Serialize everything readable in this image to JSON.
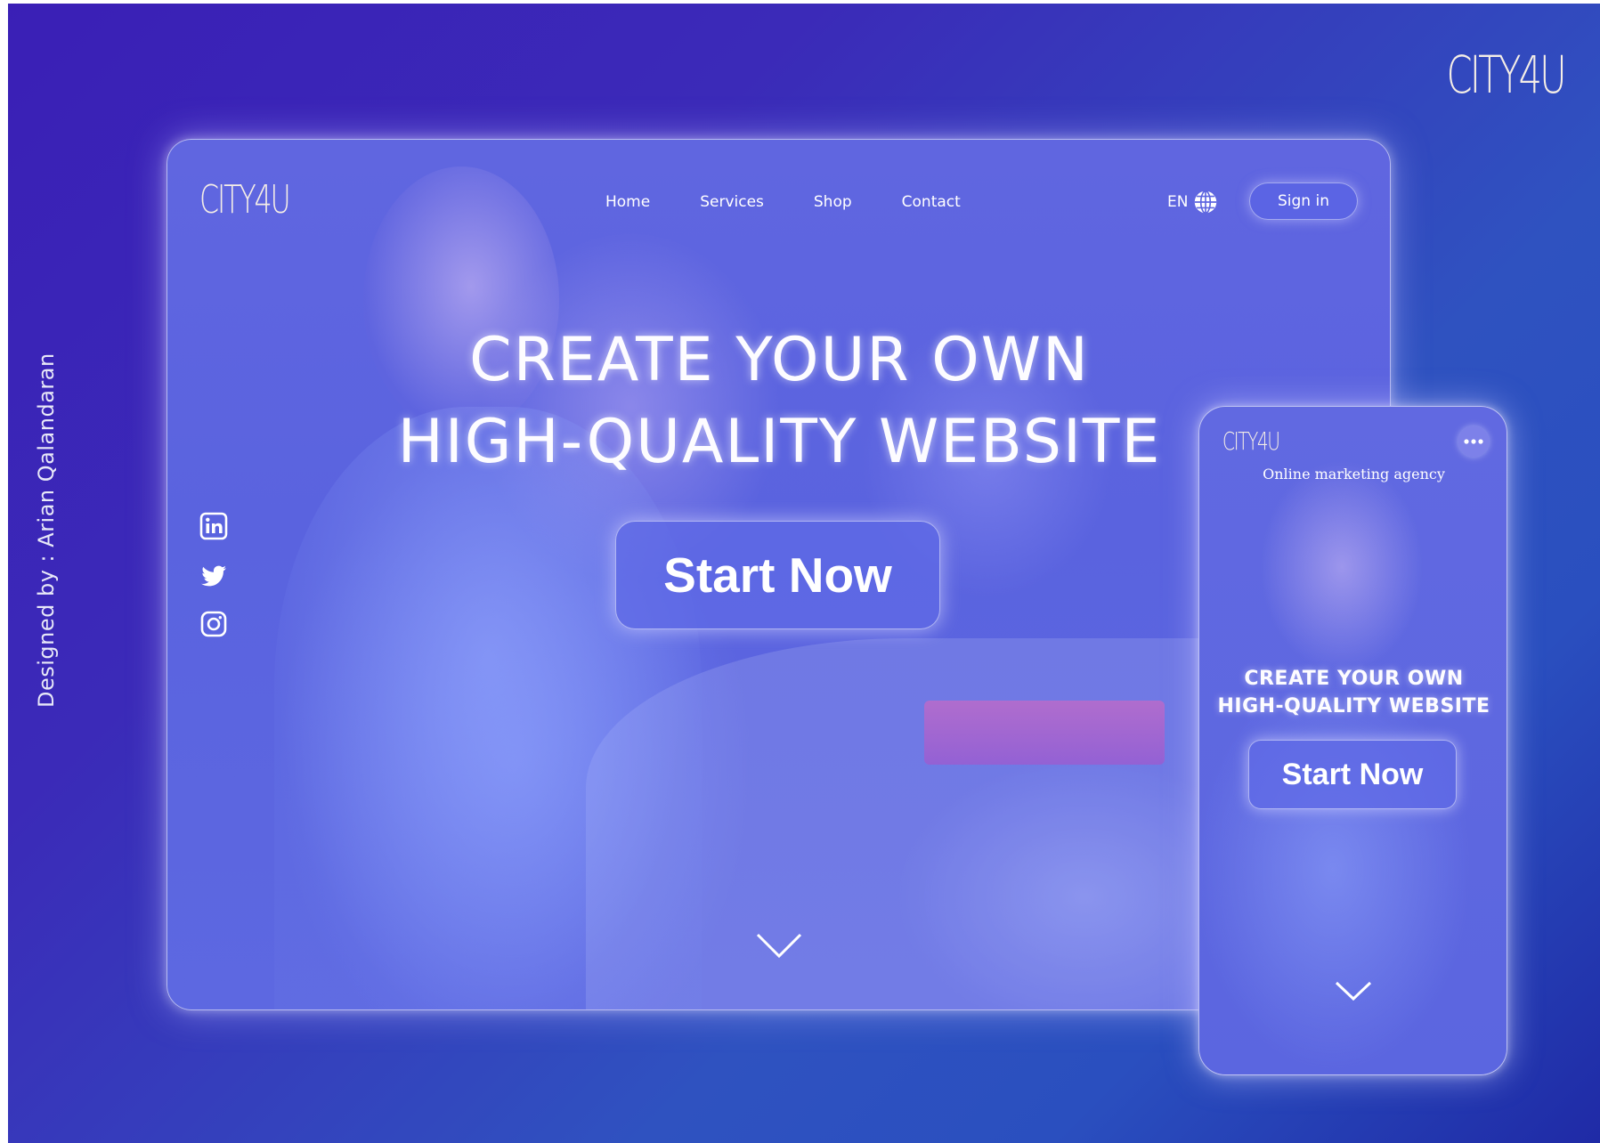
{
  "brand": "CITY4U",
  "credit": "Designed by : Arian Qalandaran",
  "desktop": {
    "logo": "CITY4U",
    "nav": [
      "Home",
      "Services",
      "Shop",
      "Contact"
    ],
    "language": "EN",
    "sign_in": "Sign in",
    "hero_line1": "CREATE YOUR OWN",
    "hero_line2": "HIGH-QUALITY WEBSITE",
    "cta": "Start Now",
    "social_icons": [
      "linkedin-icon",
      "twitter-icon",
      "instagram-icon"
    ]
  },
  "mobile": {
    "logo": "CITY4U",
    "tagline": "Online marketing agency",
    "hero_line1": "CREATE YOUR OWN",
    "hero_line2": "HIGH-QUALITY WEBSITE",
    "cta": "Start Now"
  },
  "colors": {
    "background_start": "#3a1fb6",
    "background_end": "#2a4fbf",
    "card_tint": "#5d65e0",
    "logo": "#f5eee6",
    "text": "#ffffff"
  }
}
